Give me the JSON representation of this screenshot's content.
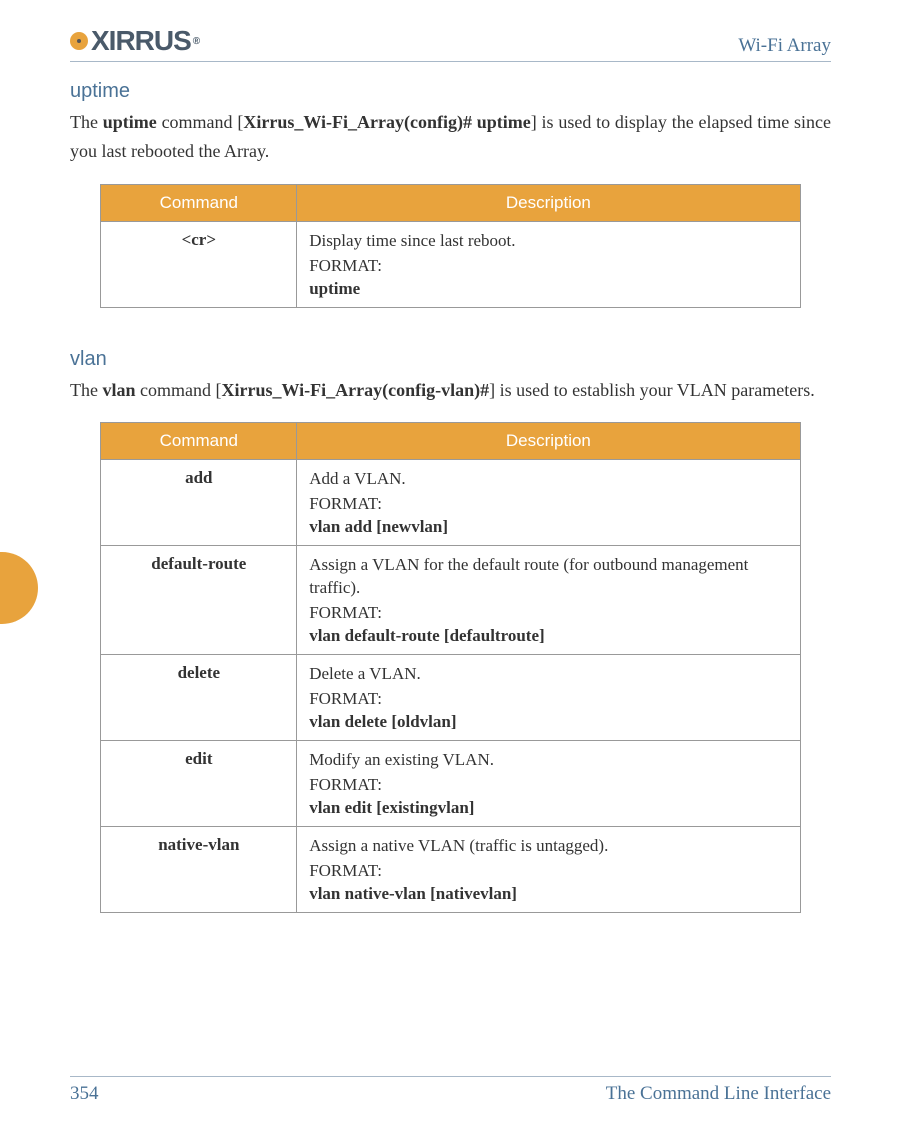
{
  "header": {
    "logo_text": "XIRRUS",
    "product": "Wi-Fi Array"
  },
  "sections": {
    "uptime": {
      "title": "uptime",
      "intro_pre": "The ",
      "intro_cmd": "uptime",
      "intro_mid": " command [",
      "intro_prompt": "Xirrus_Wi-Fi_Array(config)# uptime",
      "intro_post": "] is used to display the elapsed time since you last rebooted the Array.",
      "table_headers": {
        "cmd": "Command",
        "desc": "Description"
      },
      "rows": [
        {
          "cmd": "<cr>",
          "desc": "Display time since last reboot.",
          "format_label": "FORMAT:",
          "syntax": "uptime"
        }
      ]
    },
    "vlan": {
      "title": "vlan",
      "intro_pre": "The ",
      "intro_cmd": "vlan",
      "intro_mid": " command [",
      "intro_prompt": "Xirrus_Wi-Fi_Array(config-vlan)#",
      "intro_post": "] is used to establish your VLAN parameters.",
      "table_headers": {
        "cmd": "Command",
        "desc": "Description"
      },
      "rows": [
        {
          "cmd": "add",
          "desc": "Add a VLAN.",
          "format_label": "FORMAT:",
          "syntax": "vlan add [newvlan]"
        },
        {
          "cmd": "default-route",
          "desc": "Assign a VLAN for the default route (for outbound management traffic).",
          "format_label": "FORMAT:",
          "syntax": "vlan default-route [defaultroute]"
        },
        {
          "cmd": "delete",
          "desc": "Delete a VLAN.",
          "format_label": "FORMAT:",
          "syntax": "vlan delete [oldvlan]"
        },
        {
          "cmd": "edit",
          "desc": "Modify an existing VLAN.",
          "format_label": "FORMAT:",
          "syntax": "vlan edit [existingvlan]"
        },
        {
          "cmd": "native-vlan",
          "desc": "Assign a native VLAN (traffic is untagged).",
          "format_label": "FORMAT:",
          "syntax": "vlan native-vlan [nativevlan]"
        }
      ]
    }
  },
  "footer": {
    "page": "354",
    "title": "The Command Line Interface"
  }
}
